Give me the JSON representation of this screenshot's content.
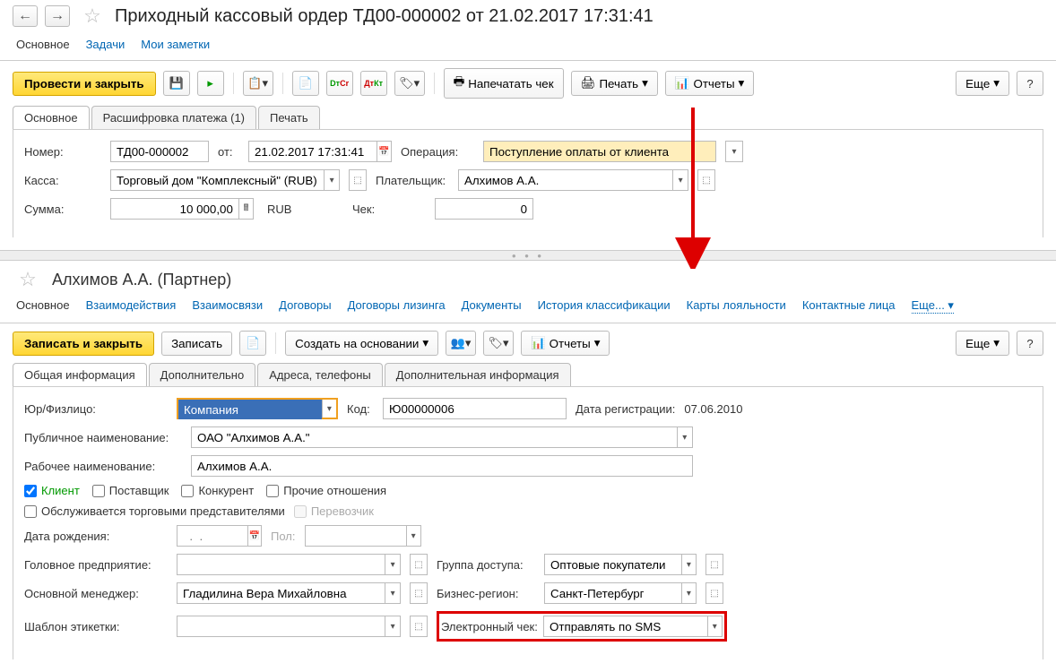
{
  "top": {
    "title": "Приходный кассовый ордер ТД00-000002 от 21.02.2017 17:31:41",
    "sections": {
      "main": "Основное",
      "tasks": "Задачи",
      "notes": "Мои заметки"
    },
    "toolbar": {
      "post_close": "Провести и закрыть",
      "print_check": "Напечатать чек",
      "print": "Печать",
      "reports": "Отчеты",
      "more": "Еще"
    },
    "tabs": {
      "main": "Основное",
      "decode": "Расшифровка платежа (1)",
      "print": "Печать"
    },
    "form": {
      "number_label": "Номер:",
      "number": "ТД00-000002",
      "from_label": "от:",
      "date": "21.02.2017 17:31:41",
      "operation_label": "Операция:",
      "operation": "Поступление оплаты от клиента",
      "kassa_label": "Касса:",
      "kassa": "Торговый дом \"Комплексный\" (RUB)",
      "payer_label": "Плательщик:",
      "payer": "Алхимов А.А.",
      "sum_label": "Сумма:",
      "sum": "10 000,00",
      "currency": "RUB",
      "check_label": "Чек:",
      "check": "0"
    }
  },
  "partner": {
    "title": "Алхимов А.А. (Партнер)",
    "nav": {
      "main": "Основное",
      "interactions": "Взаимодействия",
      "relations": "Взаимосвязи",
      "contracts": "Договоры",
      "leasing": "Договоры лизинга",
      "documents": "Документы",
      "history": "История классификации",
      "loyalty": "Карты лояльности",
      "contacts": "Контактные лица",
      "more": "Еще..."
    },
    "toolbar": {
      "save_close": "Записать и закрыть",
      "save": "Записать",
      "create_based": "Создать на основании",
      "reports": "Отчеты",
      "more": "Еще"
    },
    "tabs": {
      "general": "Общая информация",
      "additional": "Дополнительно",
      "addresses": "Адреса, телефоны",
      "addinfo": "Дополнительная информация"
    },
    "form": {
      "yur_label": "Юр/Физлицо:",
      "yur": "Компания",
      "code_label": "Код:",
      "code": "Ю00000006",
      "regdate_label": "Дата регистрации:",
      "regdate": "07.06.2010",
      "pubname_label": "Публичное наименование:",
      "pubname": "ОАО \"Алхимов А.А.\"",
      "workname_label": "Рабочее наименование:",
      "workname": "Алхимов А.А.",
      "client": "Клиент",
      "supplier": "Поставщик",
      "competitor": "Конкурент",
      "other_rel": "Прочие отношения",
      "served": "Обслуживается торговыми представителями",
      "carrier": "Перевозчик",
      "birth_label": "Дата рождения:",
      "birth_placeholder": "  .  .    ",
      "gender_label": "Пол:",
      "parent_label": "Головное предприятие:",
      "access_label": "Группа доступа:",
      "access": "Оптовые покупатели",
      "manager_label": "Основной менеджер:",
      "manager": "Гладилина Вера Михайловна",
      "region_label": "Бизнес-регион:",
      "region": "Санкт-Петербург",
      "template_label": "Шаблон этикетки:",
      "echeck_label": "Электронный чек:",
      "echeck": "Отправлять по SMS"
    }
  }
}
